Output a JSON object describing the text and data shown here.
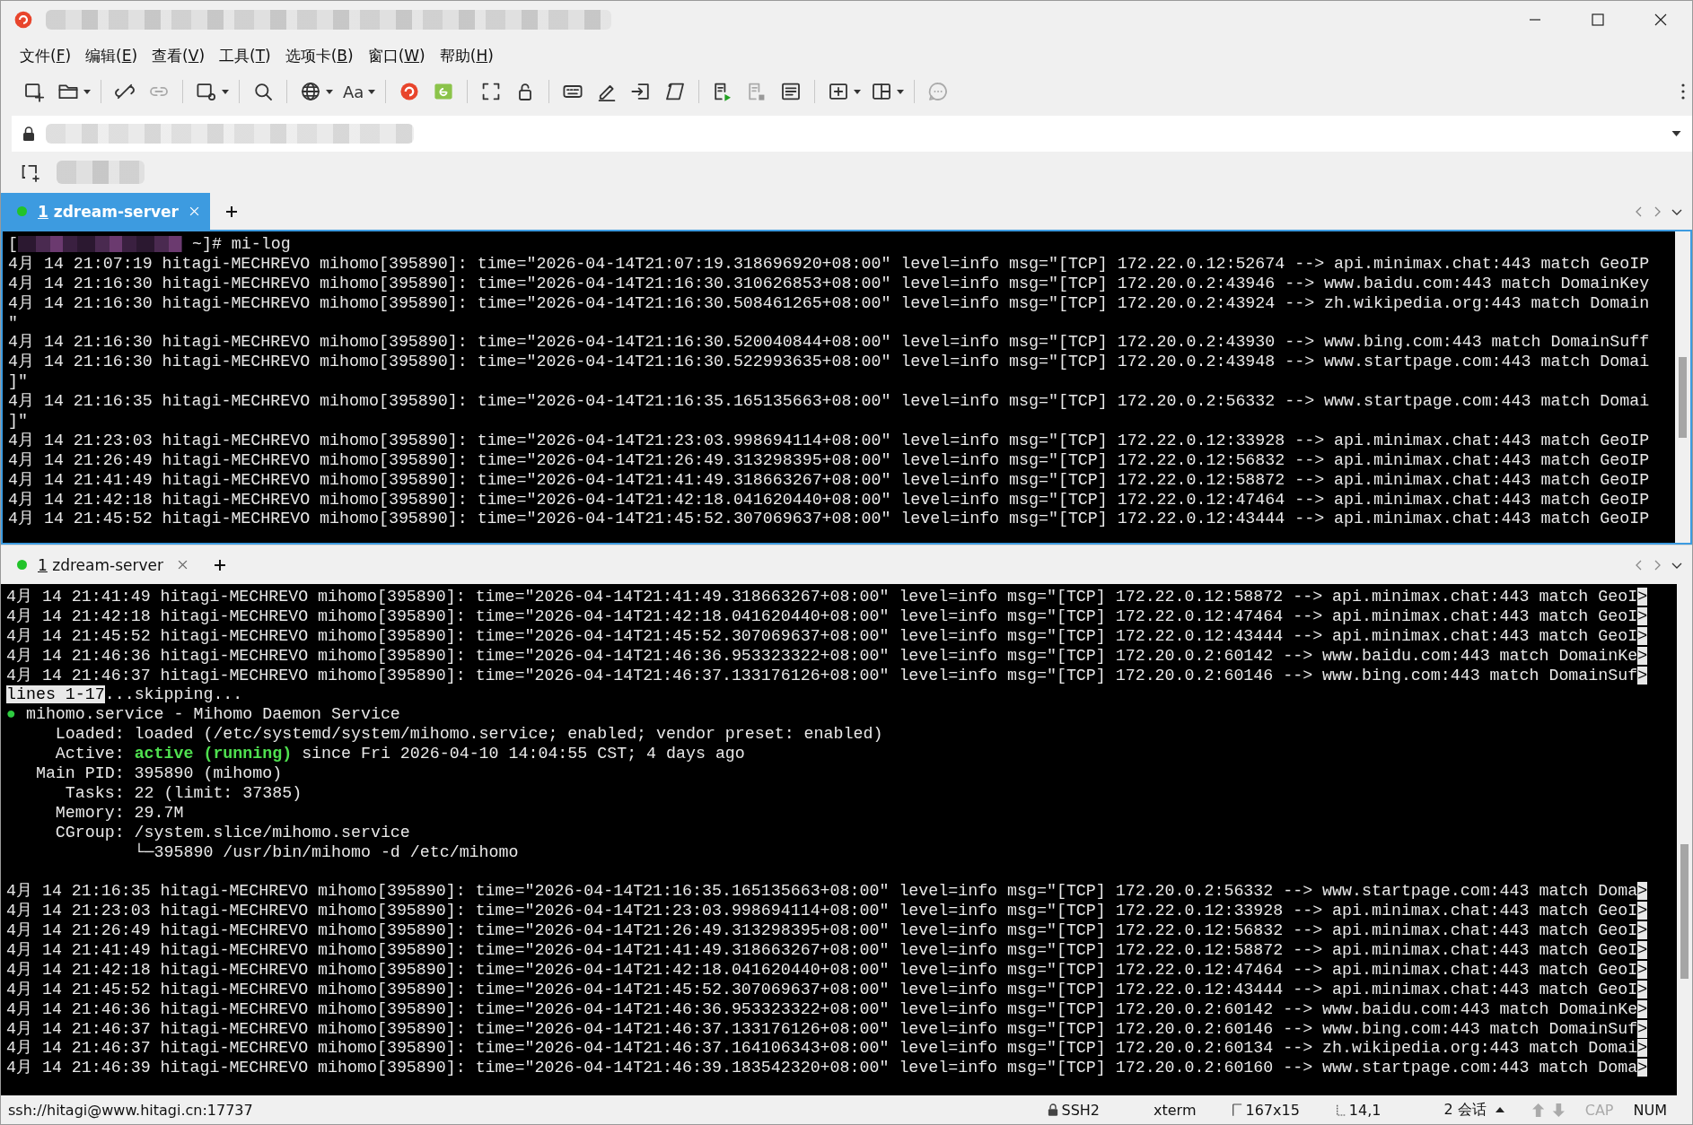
{
  "menu": [
    "文件(F)",
    "编辑(E)",
    "查看(V)",
    "工具(T)",
    "选项卡(B)",
    "窗口(W)",
    "帮助(H)"
  ],
  "toolbar": {
    "font_label": "Aa"
  },
  "panes": [
    {
      "tabs": [
        {
          "number": "1",
          "label": "zdream-server",
          "selected": true,
          "connected": true
        }
      ],
      "lines": [
        {
          "segments": [
            {
              "text": "["
            },
            {
              "kind": "redacted"
            },
            {
              "text": " ~]# mi-log"
            }
          ]
        },
        {
          "text": "4月 14 21:07:19 hitagi-MECHREVO mihomo[395890]: time=\"2026-04-14T21:07:19.318696920+08:00\" level=info msg=\"[TCP] 172.22.0.12:52674 --> api.minimax.chat:443 match GeoIP"
        },
        {
          "text": "4月 14 21:16:30 hitagi-MECHREVO mihomo[395890]: time=\"2026-04-14T21:16:30.310626853+08:00\" level=info msg=\"[TCP] 172.20.0.2:43946 --> www.baidu.com:443 match DomainKey"
        },
        {
          "text": "4月 14 21:16:30 hitagi-MECHREVO mihomo[395890]: time=\"2026-04-14T21:16:30.508461265+08:00\" level=info msg=\"[TCP] 172.20.0.2:43924 --> zh.wikipedia.org:443 match Domain"
        },
        {
          "text": "\""
        },
        {
          "text": "4月 14 21:16:30 hitagi-MECHREVO mihomo[395890]: time=\"2026-04-14T21:16:30.520040844+08:00\" level=info msg=\"[TCP] 172.20.0.2:43930 --> www.bing.com:443 match DomainSuff"
        },
        {
          "text": "4月 14 21:16:30 hitagi-MECHREVO mihomo[395890]: time=\"2026-04-14T21:16:30.522993635+08:00\" level=info msg=\"[TCP] 172.20.0.2:43948 --> www.startpage.com:443 match Domai"
        },
        {
          "text": "]\""
        },
        {
          "text": "4月 14 21:16:35 hitagi-MECHREVO mihomo[395890]: time=\"2026-04-14T21:16:35.165135663+08:00\" level=info msg=\"[TCP] 172.20.0.2:56332 --> www.startpage.com:443 match Domai"
        },
        {
          "text": "]\""
        },
        {
          "text": "4月 14 21:23:03 hitagi-MECHREVO mihomo[395890]: time=\"2026-04-14T21:23:03.998694114+08:00\" level=info msg=\"[TCP] 172.22.0.12:33928 --> api.minimax.chat:443 match GeoIP"
        },
        {
          "text": "4月 14 21:26:49 hitagi-MECHREVO mihomo[395890]: time=\"2026-04-14T21:26:49.313298395+08:00\" level=info msg=\"[TCP] 172.22.0.12:56832 --> api.minimax.chat:443 match GeoIP"
        },
        {
          "text": "4月 14 21:41:49 hitagi-MECHREVO mihomo[395890]: time=\"2026-04-14T21:41:49.318663267+08:00\" level=info msg=\"[TCP] 172.22.0.12:58872 --> api.minimax.chat:443 match GeoIP"
        },
        {
          "text": "4月 14 21:42:18 hitagi-MECHREVO mihomo[395890]: time=\"2026-04-14T21:42:18.041620440+08:00\" level=info msg=\"[TCP] 172.22.0.12:47464 --> api.minimax.chat:443 match GeoIP"
        },
        {
          "text": "4月 14 21:45:52 hitagi-MECHREVO mihomo[395890]: time=\"2026-04-14T21:45:52.307069637+08:00\" level=info msg=\"[TCP] 172.22.0.12:43444 --> api.minimax.chat:443 match GeoIP"
        }
      ]
    },
    {
      "tabs": [
        {
          "number": "1",
          "label": "zdream-server",
          "selected": false,
          "connected": true
        }
      ],
      "lines": [
        {
          "segments": [
            {
              "text": "4月 14 21:41:49 hitagi-MECHREVO mihomo[395890]: time=\"2026-04-14T21:41:49.318663267+08:00\" level=info msg=\"[TCP] 172.22.0.12:58872 --> api.minimax.chat:443 match GeoI"
            },
            {
              "text": ">",
              "kind": "inverse"
            }
          ]
        },
        {
          "segments": [
            {
              "text": "4月 14 21:42:18 hitagi-MECHREVO mihomo[395890]: time=\"2026-04-14T21:42:18.041620440+08:00\" level=info msg=\"[TCP] 172.22.0.12:47464 --> api.minimax.chat:443 match GeoI"
            },
            {
              "text": ">",
              "kind": "inverse"
            }
          ]
        },
        {
          "segments": [
            {
              "text": "4月 14 21:45:52 hitagi-MECHREVO mihomo[395890]: time=\"2026-04-14T21:45:52.307069637+08:00\" level=info msg=\"[TCP] 172.22.0.12:43444 --> api.minimax.chat:443 match GeoI"
            },
            {
              "text": ">",
              "kind": "inverse"
            }
          ]
        },
        {
          "segments": [
            {
              "text": "4月 14 21:46:36 hitagi-MECHREVO mihomo[395890]: time=\"2026-04-14T21:46:36.953323322+08:00\" level=info msg=\"[TCP] 172.20.0.2:60142 --> www.baidu.com:443 match DomainKe"
            },
            {
              "text": ">",
              "kind": "inverse"
            }
          ]
        },
        {
          "segments": [
            {
              "text": "4月 14 21:46:37 hitagi-MECHREVO mihomo[395890]: time=\"2026-04-14T21:46:37.133176126+08:00\" level=info msg=\"[TCP] 172.20.0.2:60146 --> www.bing.com:443 match DomainSuf"
            },
            {
              "text": ">",
              "kind": "inverse"
            }
          ]
        },
        {
          "segments": [
            {
              "text": "lines 1-17",
              "kind": "inverse"
            },
            {
              "text": "...skipping..."
            }
          ]
        },
        {
          "segments": [
            {
              "text": "●",
              "kind": "green"
            },
            {
              "text": " mihomo.service - Mihomo Daemon Service"
            }
          ]
        },
        {
          "text": "     Loaded: loaded (/etc/systemd/system/mihomo.service; enabled; vendor preset: enabled)"
        },
        {
          "segments": [
            {
              "text": "     Active: "
            },
            {
              "text": "active (running)",
              "kind": "green-bold"
            },
            {
              "text": " since Fri 2026-04-10 14:04:55 CST; 4 days ago"
            }
          ]
        },
        {
          "text": "   Main PID: 395890 (mihomo)"
        },
        {
          "text": "      Tasks: 22 (limit: 37385)"
        },
        {
          "text": "     Memory: 29.7M"
        },
        {
          "text": "     CGroup: /system.slice/mihomo.service"
        },
        {
          "text": "             └─395890 /usr/bin/mihomo -d /etc/mihomo"
        },
        {
          "gap_before": true,
          "segments": [
            {
              "text": "4月 14 21:16:35 hitagi-MECHREVO mihomo[395890]: time=\"2026-04-14T21:16:35.165135663+08:00\" level=info msg=\"[TCP] 172.20.0.2:56332 --> www.startpage.com:443 match Doma"
            },
            {
              "text": ">",
              "kind": "inverse"
            }
          ]
        },
        {
          "segments": [
            {
              "text": "4月 14 21:23:03 hitagi-MECHREVO mihomo[395890]: time=\"2026-04-14T21:23:03.998694114+08:00\" level=info msg=\"[TCP] 172.22.0.12:33928 --> api.minimax.chat:443 match GeoI"
            },
            {
              "text": ">",
              "kind": "inverse"
            }
          ]
        },
        {
          "segments": [
            {
              "text": "4月 14 21:26:49 hitagi-MECHREVO mihomo[395890]: time=\"2026-04-14T21:26:49.313298395+08:00\" level=info msg=\"[TCP] 172.22.0.12:56832 --> api.minimax.chat:443 match GeoI"
            },
            {
              "text": ">",
              "kind": "inverse"
            }
          ]
        },
        {
          "segments": [
            {
              "text": "4月 14 21:41:49 hitagi-MECHREVO mihomo[395890]: time=\"2026-04-14T21:41:49.318663267+08:00\" level=info msg=\"[TCP] 172.22.0.12:58872 --> api.minimax.chat:443 match GeoI"
            },
            {
              "text": ">",
              "kind": "inverse"
            }
          ]
        },
        {
          "segments": [
            {
              "text": "4月 14 21:42:18 hitagi-MECHREVO mihomo[395890]: time=\"2026-04-14T21:42:18.041620440+08:00\" level=info msg=\"[TCP] 172.22.0.12:47464 --> api.minimax.chat:443 match GeoI"
            },
            {
              "text": ">",
              "kind": "inverse"
            }
          ]
        },
        {
          "segments": [
            {
              "text": "4月 14 21:45:52 hitagi-MECHREVO mihomo[395890]: time=\"2026-04-14T21:45:52.307069637+08:00\" level=info msg=\"[TCP] 172.22.0.12:43444 --> api.minimax.chat:443 match GeoI"
            },
            {
              "text": ">",
              "kind": "inverse"
            }
          ]
        },
        {
          "segments": [
            {
              "text": "4月 14 21:46:36 hitagi-MECHREVO mihomo[395890]: time=\"2026-04-14T21:46:36.953323322+08:00\" level=info msg=\"[TCP] 172.20.0.2:60142 --> www.baidu.com:443 match DomainKe"
            },
            {
              "text": ">",
              "kind": "inverse"
            }
          ]
        },
        {
          "segments": [
            {
              "text": "4月 14 21:46:37 hitagi-MECHREVO mihomo[395890]: time=\"2026-04-14T21:46:37.133176126+08:00\" level=info msg=\"[TCP] 172.20.0.2:60146 --> www.bing.com:443 match DomainSuf"
            },
            {
              "text": ">",
              "kind": "inverse"
            }
          ]
        },
        {
          "segments": [
            {
              "text": "4月 14 21:46:37 hitagi-MECHREVO mihomo[395890]: time=\"2026-04-14T21:46:37.164106343+08:00\" level=info msg=\"[TCP] 172.20.0.2:60134 --> zh.wikipedia.org:443 match Domai"
            },
            {
              "text": ">",
              "kind": "inverse"
            }
          ]
        },
        {
          "segments": [
            {
              "text": "4月 14 21:46:39 hitagi-MECHREVO mihomo[395890]: time=\"2026-04-14T21:46:39.183542320+08:00\" level=info msg=\"[TCP] 172.20.0.2:60160 --> www.startpage.com:443 match Doma"
            },
            {
              "text": ">",
              "kind": "inverse"
            }
          ]
        }
      ]
    }
  ],
  "status_bar": {
    "connection": "ssh://hitagi@www.hitagi.cn:17737",
    "protocol": "SSH2",
    "terminal_type": "xterm",
    "size": "167x15",
    "cursor": "14,1",
    "sessions": "2 会话",
    "indicators": [
      {
        "label": "CAP",
        "on": false
      },
      {
        "label": "NUM",
        "on": true
      }
    ]
  }
}
